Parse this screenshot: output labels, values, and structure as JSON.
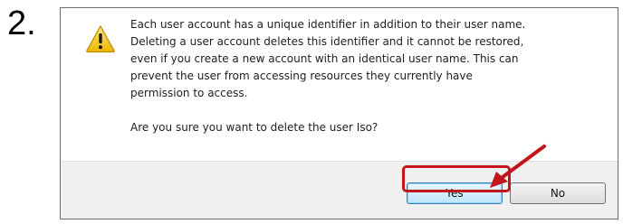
{
  "step": {
    "number": "2."
  },
  "dialog": {
    "icon": "warning-icon",
    "message": "Each user account has a unique identifier in addition to their user name. Deleting a user account deletes this identifier and it cannot be restored, even if you create a new account with an identical user name. This can prevent the user from accessing resources they currently have permission to access.",
    "message_lines": [
      "Each user account has a unique identifier in addition to their user name.",
      "Deleting a user account deletes this identifier and it cannot be restored,",
      "even if you create a new account with an identical user name. This can",
      "prevent the user from accessing resources they currently have",
      "permission to access."
    ],
    "question": "Are you sure you want to delete the user Iso?",
    "buttons": {
      "yes_label": "Yes",
      "no_label": "No"
    }
  },
  "annotation": {
    "arrow_color": "#c1161c",
    "highlight_target": "yes-button"
  },
  "colors": {
    "warning_fill": "#f7d13c",
    "warning_stroke": "#b88a00"
  }
}
